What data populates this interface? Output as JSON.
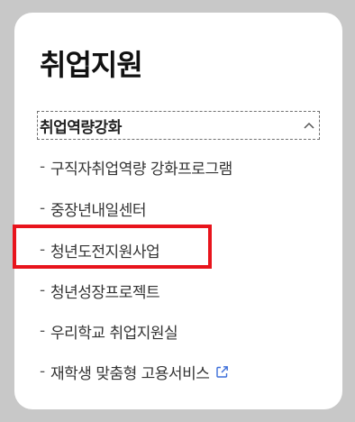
{
  "panel": {
    "title": "취업지원"
  },
  "section": {
    "label": "취업역량강화",
    "expanded": true,
    "icon": "chevron-up-icon"
  },
  "menu": {
    "items": [
      {
        "label": "구직자취업역량 강화프로그램"
      },
      {
        "label": "중장년내일센터"
      },
      {
        "label": "청년도전지원사업",
        "highlighted": true
      },
      {
        "label": "청년성장프로젝트"
      },
      {
        "label": "우리학교 취업지원실"
      },
      {
        "label": "재학생 맞춤형 고용서비스",
        "external": true,
        "icon": "external-link-icon"
      }
    ]
  },
  "colors": {
    "background": "#c8c8c8",
    "panel": "#ffffff",
    "highlight": "#e8141c",
    "external_icon": "#3d6fd9"
  }
}
